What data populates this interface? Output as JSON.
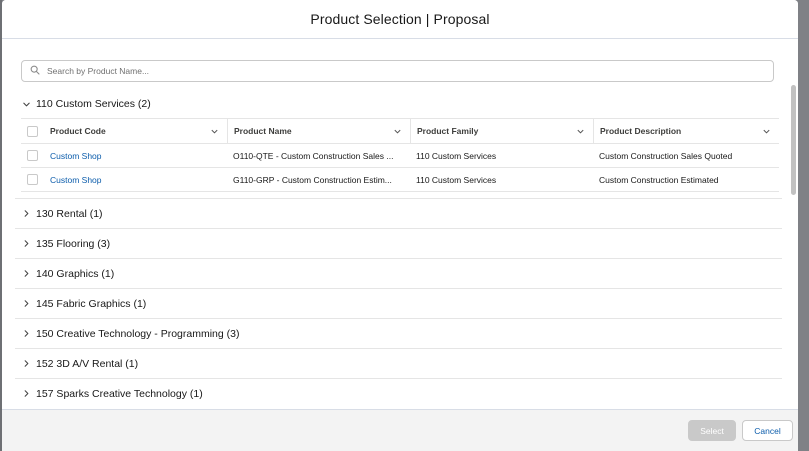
{
  "modal": {
    "title": "Product Selection | Proposal"
  },
  "search": {
    "placeholder": "Search by Product Name..."
  },
  "expanded_section": {
    "label": "110 Custom Services (2)",
    "columns": [
      "Product Code",
      "Product Name",
      "Product Family",
      "Product Description"
    ],
    "rows": [
      {
        "code": "Custom Shop",
        "name": "O110-QTE - Custom Construction Sales ...",
        "family": "110 Custom Services",
        "description": "Custom Construction Sales Quoted"
      },
      {
        "code": "Custom Shop",
        "name": "G110-GRP - Custom Construction Estim...",
        "family": "110 Custom Services",
        "description": "Custom Construction Estimated"
      }
    ]
  },
  "collapsed_sections": [
    {
      "label": "130 Rental (1)"
    },
    {
      "label": "135 Flooring (3)"
    },
    {
      "label": "140 Graphics (1)"
    },
    {
      "label": "145 Fabric Graphics (1)"
    },
    {
      "label": "150 Creative Technology - Programming (3)"
    },
    {
      "label": "152 3D A/V Rental (1)"
    },
    {
      "label": "157 Sparks Creative Technology (1)"
    }
  ],
  "footer": {
    "select_label": "Select",
    "cancel_label": "Cancel"
  },
  "colors": {
    "link": "#0b5cab",
    "backdrop": "#7f8186",
    "footer_bg": "#f3f3f3"
  },
  "icons": {
    "search": "search-icon",
    "expand": "chevron-down-icon",
    "collapse": "chevron-right-icon",
    "column_menu": "chevron-down-icon"
  }
}
